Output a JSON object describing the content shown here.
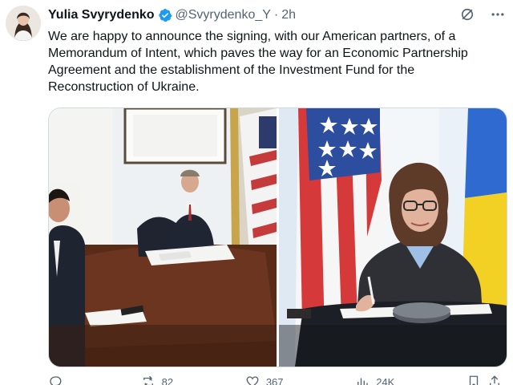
{
  "tweet": {
    "author_name": "Yulia Svyrydenko",
    "handle": "@Svyrydenko_Y",
    "separator": "·",
    "time": "2h",
    "text": "We are happy to announce the signing, with our American partners, of a Memorandum of Intent, which paves the way for an Economic Partnership Agreement and the establishment of the Investment Fund for the Reconstruction of Ukraine."
  },
  "actions": {
    "replies": "",
    "reposts": "82",
    "likes": "367",
    "views": "24K"
  },
  "colors": {
    "verified": "#1d9bf0",
    "secondary_text": "#536471",
    "border": "#cfd9de"
  }
}
